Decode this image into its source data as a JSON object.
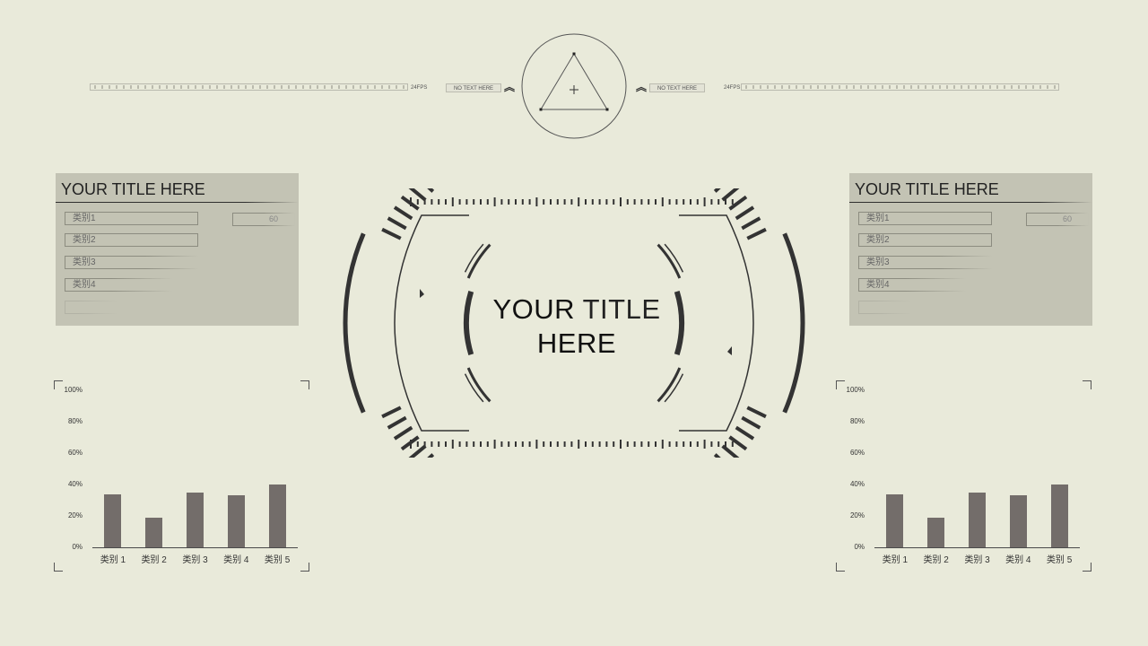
{
  "top_bar": {
    "fps_left": "24FPS",
    "fps_right": "24FPS",
    "tag_left": "NO TEXT HERE",
    "tag_right": "NO TEXT HERE",
    "chevron": "︽"
  },
  "center": {
    "title_line1_a": "YOUR",
    "title_line1_b": "TITLE",
    "title_line2": "HERE"
  },
  "left_panel": {
    "title": "YOUR TITLE HERE",
    "items": [
      "类别1",
      "类别2",
      "类别3",
      "类别4"
    ],
    "value": "60"
  },
  "right_panel": {
    "title": "YOUR TITLE HERE",
    "items": [
      "类别1",
      "类别2",
      "类别3",
      "类别4"
    ],
    "value": "60"
  },
  "colors": {
    "background": "#e9eada",
    "panel": "#c3c3b4",
    "bar": "#736d6a",
    "line": "#333333"
  },
  "chart_data": [
    {
      "type": "bar",
      "categories": [
        "类别 1",
        "类别 2",
        "类别 3",
        "类别 4",
        "类别 5"
      ],
      "values": [
        34,
        19,
        35,
        33,
        40
      ],
      "yticks": [
        "0%",
        "20%",
        "40%",
        "60%",
        "80%",
        "100%"
      ],
      "ylim": [
        0,
        100
      ],
      "grid": false
    },
    {
      "type": "bar",
      "categories": [
        "类别 1",
        "类别 2",
        "类别 3",
        "类别 4",
        "类别 5"
      ],
      "values": [
        34,
        19,
        35,
        33,
        40
      ],
      "yticks": [
        "0%",
        "20%",
        "40%",
        "60%",
        "80%",
        "100%"
      ],
      "ylim": [
        0,
        100
      ],
      "grid": false
    }
  ]
}
